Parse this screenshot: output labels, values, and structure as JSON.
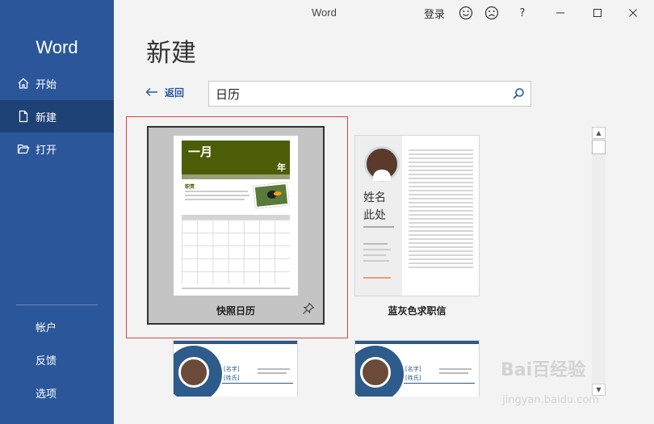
{
  "window": {
    "title": "Word",
    "login": "登录",
    "help": "?"
  },
  "sidebar": {
    "app_name": "Word",
    "items": [
      {
        "label": "开始",
        "icon": "home-icon"
      },
      {
        "label": "新建",
        "icon": "new-document-icon"
      },
      {
        "label": "打开",
        "icon": "folder-open-icon"
      }
    ],
    "bottom": [
      {
        "label": "帐户"
      },
      {
        "label": "反馈"
      },
      {
        "label": "选项"
      }
    ]
  },
  "main": {
    "title": "新建",
    "back_label": "返回",
    "search": {
      "value": "日历"
    }
  },
  "templates": [
    {
      "label": "快照日历",
      "selected": true,
      "thumb": {
        "month": "一月",
        "year": "年",
        "section_title": "职责",
        "weekdays": [
          "星期日",
          "星期一",
          "星期二",
          "星期三",
          "星期四",
          "星期五",
          "星期六"
        ]
      }
    },
    {
      "label": "蓝灰色求职信",
      "thumb": {
        "name_line1": "姓名",
        "name_line2": "此处"
      }
    },
    {
      "label": "",
      "thumb": {
        "tag1": "[名字]",
        "tag2": "[姓氏]"
      }
    },
    {
      "label": "",
      "thumb": {
        "tag1": "[名字]",
        "tag2": "[姓氏]"
      }
    }
  ],
  "colors": {
    "sidebar": "#2b579a",
    "sidebar_active": "#1e4275",
    "calendar_header": "#4b5e07",
    "selection_outline": "#e04444"
  },
  "watermark": {
    "text": "Bai百经验",
    "url": "jingyan.baidu.com"
  }
}
